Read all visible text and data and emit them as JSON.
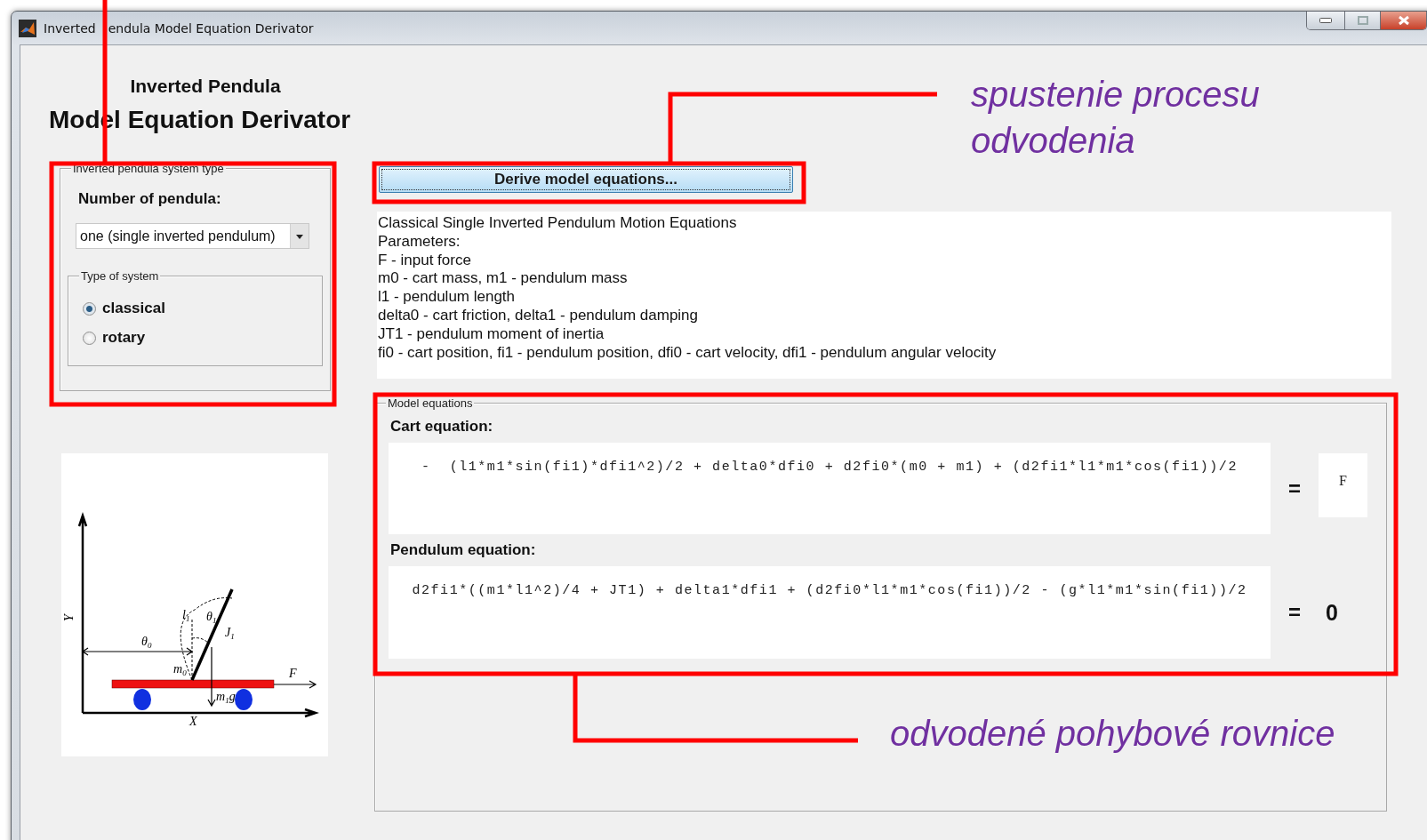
{
  "window": {
    "title_fragments": [
      "Inverted",
      "endula Model Equation Derivator"
    ]
  },
  "header": {
    "subtitle": "Inverted Pendula",
    "title": "Model Equation Derivator"
  },
  "system_panel": {
    "legend": "Inverted pendula system type",
    "count_label": "Number of pendula:",
    "count_dropdown": {
      "value": "one (single inverted pendulum)"
    },
    "type_group": {
      "legend": "Type of system",
      "options": [
        {
          "label": "classical",
          "selected": true
        },
        {
          "label": "rotary",
          "selected": false
        }
      ]
    }
  },
  "diagram": {
    "labels": [
      {
        "text": "Y",
        "rotated": true
      },
      {
        "text": "θ",
        "sub": "0",
        "rotated": false
      },
      {
        "text": "l",
        "sub": "1",
        "rotated": false
      },
      {
        "text": "θ",
        "sub": "1",
        "rotated": false
      },
      {
        "text": "J",
        "sub": "1",
        "rotated": false
      },
      {
        "text": "m",
        "sub": "0",
        "rotated": false
      },
      {
        "text": "F",
        "rotated": false
      },
      {
        "text": "m",
        "sub": "1",
        "after": "g",
        "rotated": false
      },
      {
        "text": "X",
        "rotated": false
      }
    ]
  },
  "derive_button": {
    "label": "Derive model equations..."
  },
  "description": {
    "lines": [
      "Classical Single Inverted Pendulum Motion Equations",
      "Parameters:",
      "F - input force",
      "m0 - cart mass, m1 - pendulum mass",
      "l1 - pendulum length",
      "delta0 - cart friction, delta1 - pendulum damping",
      "JT1 - pendulum moment of inertia",
      "fi0 - cart position, fi1 - pendulum position, dfi0 - cart velocity, dfi1 - pendulum angular velocity"
    ]
  },
  "equations_panel": {
    "legend": "Model equations",
    "equations": [
      {
        "label": "Cart equation:",
        "lhs": "-  (l1*m1*sin(fi1)*dfi1^2)/2 + delta0*dfi0 + d2fi0*(m0 + m1) + (d2fi1*l1*m1*cos(fi1))/2",
        "equals": "=",
        "rhs": "F",
        "kind": "boxed"
      },
      {
        "label": "Pendulum equation:",
        "lhs": "d2fi1*((m1*l1^2)/4 + JT1) + delta1*dfi1 + (d2fi0*l1*m1*cos(fi1))/2 - (g*l1*m1*sin(fi1))/2",
        "equals": "=",
        "rhs": "0",
        "kind": "plain"
      }
    ]
  },
  "annotations": [
    {
      "text": "spustenie procesu odvodenia"
    },
    {
      "text": "odvodené pohybové rovnice"
    }
  ]
}
